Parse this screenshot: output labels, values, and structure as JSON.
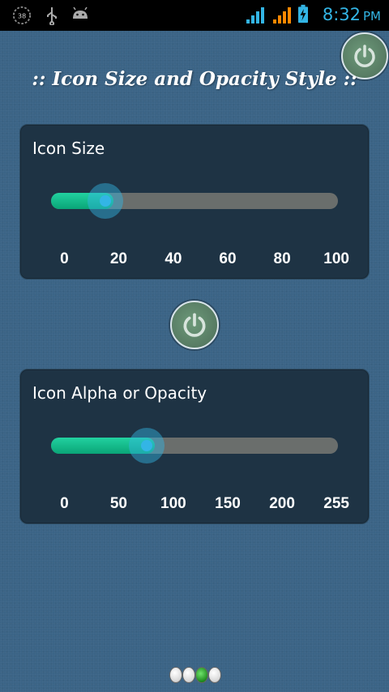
{
  "status_bar": {
    "battery_percent_icon": "38",
    "left_icons": [
      "notification-38-icon",
      "usb-icon",
      "android-icon"
    ],
    "right_icons": [
      "signal-blue-icon",
      "signal-orange-icon",
      "battery-charging-icon"
    ],
    "time": "8:32",
    "ampm": "PM"
  },
  "title": ":: Icon Size and Opacity Style ::",
  "size_panel": {
    "label": "Icon Size",
    "value": 19,
    "min": 0,
    "max": 100,
    "ticks": [
      "0",
      "20",
      "40",
      "60",
      "80",
      "100"
    ]
  },
  "alpha_panel": {
    "label": "Icon Alpha or Opacity",
    "value": 85,
    "min": 0,
    "max": 255,
    "ticks": [
      "0",
      "50",
      "100",
      "150",
      "200",
      "255"
    ]
  },
  "pager": {
    "count": 4,
    "active_index": 2
  },
  "colors": {
    "accent": "#33b5e5",
    "fill_green": "#0aa577",
    "background": "#3b6486",
    "panel": "#1e3344"
  }
}
